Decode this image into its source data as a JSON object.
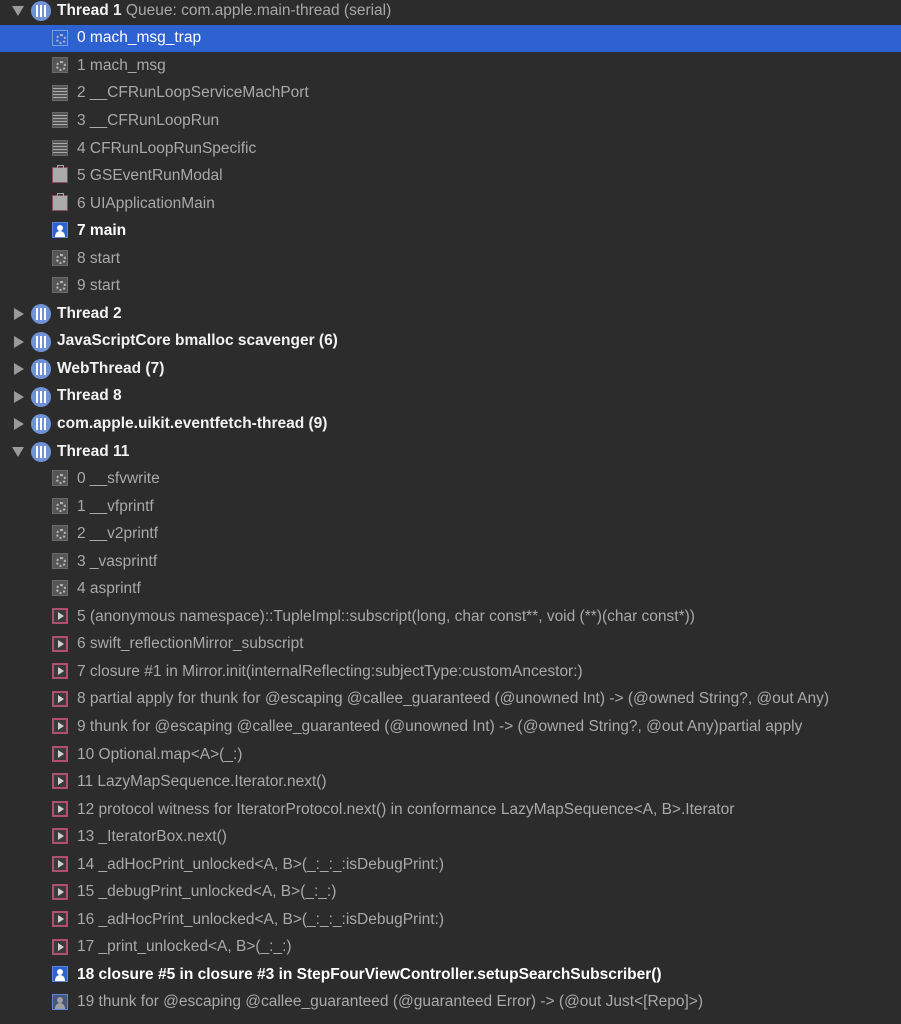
{
  "colors": {
    "background": "#2c2c2c",
    "selection": "#2d62d0",
    "thread_icon": "#6f93d6",
    "swift_frame": "#b0506e"
  },
  "rows": [
    {
      "kind": "thread",
      "expanded": true,
      "label": "Thread 1",
      "queue": "Queue: com.apple.main-thread (serial)"
    },
    {
      "kind": "frame",
      "icon": "gear",
      "label": "0 mach_msg_trap",
      "selected": true
    },
    {
      "kind": "frame",
      "icon": "gear",
      "label": "1 mach_msg"
    },
    {
      "kind": "frame",
      "icon": "grid",
      "label": "2 __CFRunLoopServiceMachPort"
    },
    {
      "kind": "frame",
      "icon": "grid",
      "label": "3 __CFRunLoopRun"
    },
    {
      "kind": "frame",
      "icon": "grid",
      "label": "4 CFRunLoopRunSpecific"
    },
    {
      "kind": "frame",
      "icon": "brief",
      "label": "5 GSEventRunModal"
    },
    {
      "kind": "frame",
      "icon": "brief",
      "label": "6 UIApplicationMain"
    },
    {
      "kind": "frame",
      "icon": "user",
      "label": "7 main",
      "bright": true
    },
    {
      "kind": "frame",
      "icon": "gear",
      "label": "8 start"
    },
    {
      "kind": "frame",
      "icon": "gear",
      "label": "9 start"
    },
    {
      "kind": "thread",
      "expanded": false,
      "label": "Thread 2"
    },
    {
      "kind": "thread",
      "expanded": false,
      "label": "JavaScriptCore bmalloc scavenger (6)"
    },
    {
      "kind": "thread",
      "expanded": false,
      "label": "WebThread (7)"
    },
    {
      "kind": "thread",
      "expanded": false,
      "label": "Thread 8"
    },
    {
      "kind": "thread",
      "expanded": false,
      "label": "com.apple.uikit.eventfetch-thread (9)"
    },
    {
      "kind": "thread",
      "expanded": true,
      "label": "Thread 11"
    },
    {
      "kind": "frame",
      "icon": "gear",
      "label": "0 __sfvwrite"
    },
    {
      "kind": "frame",
      "icon": "gear",
      "label": "1 __vfprintf"
    },
    {
      "kind": "frame",
      "icon": "gear",
      "label": "2 __v2printf"
    },
    {
      "kind": "frame",
      "icon": "gear",
      "label": "3 _vasprintf"
    },
    {
      "kind": "frame",
      "icon": "gear",
      "label": "4 asprintf"
    },
    {
      "kind": "frame",
      "icon": "swift",
      "label": "5 (anonymous namespace)::TupleImpl::subscript(long, char const**, void (**)(char const*))"
    },
    {
      "kind": "frame",
      "icon": "swift",
      "label": "6 swift_reflectionMirror_subscript"
    },
    {
      "kind": "frame",
      "icon": "swift",
      "label": "7 closure #1 in Mirror.init(internalReflecting:subjectType:customAncestor:)"
    },
    {
      "kind": "frame",
      "icon": "swift",
      "label": "8 partial apply for thunk for @escaping @callee_guaranteed (@unowned Int) -> (@owned String?, @out Any)"
    },
    {
      "kind": "frame",
      "icon": "swift",
      "label": "9 thunk for @escaping @callee_guaranteed (@unowned Int) -> (@owned String?, @out Any)partial apply"
    },
    {
      "kind": "frame",
      "icon": "swift",
      "label": "10 Optional.map<A>(_:)"
    },
    {
      "kind": "frame",
      "icon": "swift",
      "label": "11 LazyMapSequence.Iterator.next()"
    },
    {
      "kind": "frame",
      "icon": "swift",
      "label": "12 protocol witness for IteratorProtocol.next() in conformance LazyMapSequence<A, B>.Iterator"
    },
    {
      "kind": "frame",
      "icon": "swift",
      "label": "13 _IteratorBox.next()"
    },
    {
      "kind": "frame",
      "icon": "swift",
      "label": "14 _adHocPrint_unlocked<A, B>(_:_:_:isDebugPrint:)"
    },
    {
      "kind": "frame",
      "icon": "swift",
      "label": "15 _debugPrint_unlocked<A, B>(_:_:)"
    },
    {
      "kind": "frame",
      "icon": "swift",
      "label": "16 _adHocPrint_unlocked<A, B>(_:_:_:isDebugPrint:)"
    },
    {
      "kind": "frame",
      "icon": "swift",
      "label": "17 _print_unlocked<A, B>(_:_:)"
    },
    {
      "kind": "frame",
      "icon": "user",
      "label": "18 closure #5 in closure #3 in StepFourViewController.setupSearchSubscriber()",
      "bright": true
    },
    {
      "kind": "frame",
      "icon": "user-dim",
      "label": "19 thunk for @escaping @callee_guaranteed (@guaranteed Error) -> (@out Just<[Repo]>)"
    }
  ]
}
